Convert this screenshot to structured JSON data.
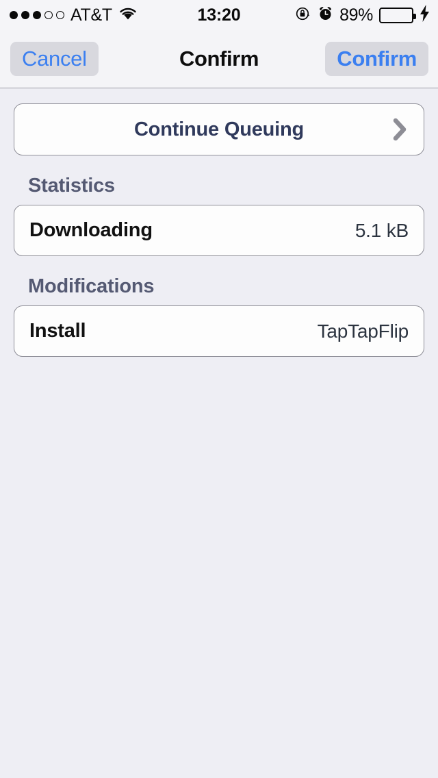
{
  "status_bar": {
    "signal_total": 5,
    "signal_filled": 3,
    "carrier": "AT&T",
    "wifi_icon": "wifi-icon",
    "time": "13:20",
    "rotation_lock_icon": "rotation-lock-icon",
    "alarm_icon": "alarm-clock-icon",
    "battery_percent": "89%",
    "battery_level": 89,
    "battery_color": "#4cd964",
    "charging_icon": "lightning-bolt-icon"
  },
  "nav_bar": {
    "cancel_label": "Cancel",
    "title": "Confirm",
    "confirm_label": "Confirm",
    "accent_color": "#3b7ff0",
    "button_background": "#d8d8de"
  },
  "main": {
    "action_row": {
      "label": "Continue Queuing",
      "chevron_icon": "chevron-right-icon"
    },
    "sections": [
      {
        "header": "Statistics",
        "rows": [
          {
            "key": "Downloading",
            "value": "5.1 kB"
          }
        ]
      },
      {
        "header": "Modifications",
        "rows": [
          {
            "key": "Install",
            "value": "TapTapFlip"
          }
        ]
      }
    ]
  }
}
